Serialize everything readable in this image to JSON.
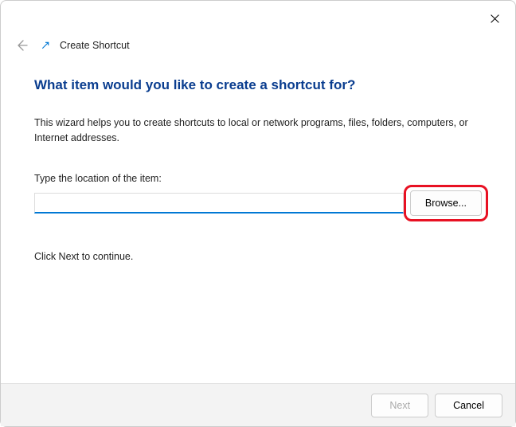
{
  "window": {
    "wizard_name": "Create Shortcut"
  },
  "main": {
    "heading": "What item would you like to create a shortcut for?",
    "description": "This wizard helps you to create shortcuts to local or network programs, files, folders, computers, or Internet addresses.",
    "input_label": "Type the location of the item:",
    "input_value": "",
    "input_placeholder": "",
    "browse_label": "Browse...",
    "continue_hint": "Click Next to continue."
  },
  "footer": {
    "next_label": "Next",
    "cancel_label": "Cancel",
    "next_enabled": false
  },
  "colors": {
    "accent": "#0078d4",
    "heading": "#0a3d8f",
    "highlight": "#e81123"
  }
}
